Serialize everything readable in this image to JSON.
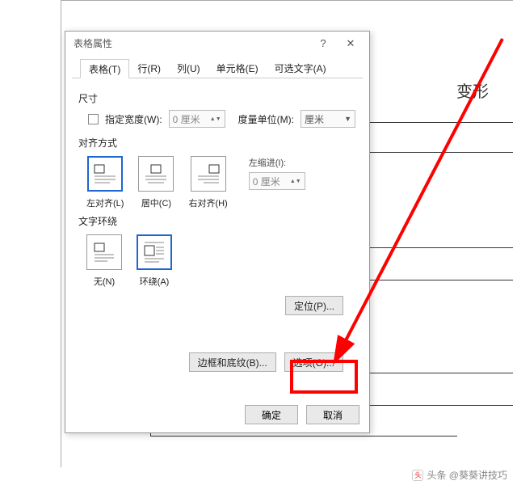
{
  "dialog": {
    "title": "表格属性",
    "help": "?",
    "close": "✕",
    "tabs": {
      "table": "表格(T)",
      "row": "行(R)",
      "col": "列(U)",
      "cell": "单元格(E)",
      "alttext": "可选文字(A)"
    },
    "size": {
      "label": "尺寸",
      "widthChk": "指定宽度(W):",
      "widthVal": "0 厘米",
      "unitLabel": "度量单位(M):",
      "unitVal": "厘米"
    },
    "align": {
      "label": "对齐方式",
      "left": "左对齐(L)",
      "center": "居中(C)",
      "right": "右对齐(H)",
      "indentLabel": "左缩进(I):",
      "indentVal": "0 厘米"
    },
    "wrap": {
      "label": "文字环绕",
      "none": "无(N)",
      "around": "环绕(A)",
      "posBtn": "定位(P)..."
    },
    "buttons": {
      "borders": "边框和底纹(B)...",
      "options": "选项(O)...",
      "ok": "确定",
      "cancel": "取消"
    }
  },
  "doc": {
    "fragment": "变形"
  },
  "watermark": "头条 @葵葵讲技巧"
}
